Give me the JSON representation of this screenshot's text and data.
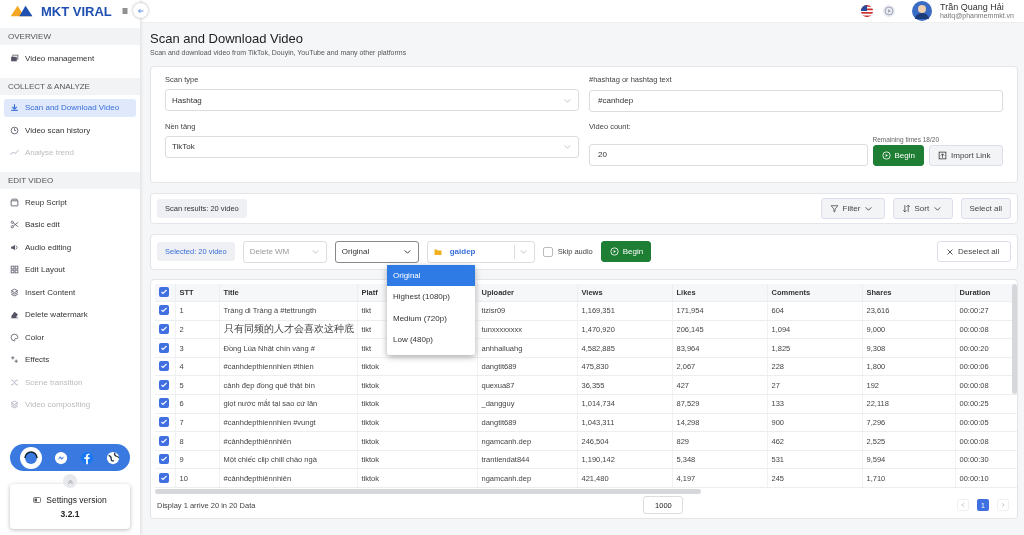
{
  "sidebar": {
    "logo": "MKT VIRAL",
    "sections": [
      {
        "title": "OVERVIEW",
        "items": [
          {
            "label": "Video management",
            "selected": false,
            "disabled": false
          }
        ]
      },
      {
        "title": "COLLECT & ANALYZE",
        "items": [
          {
            "label": "Scan and Download Video",
            "selected": true,
            "disabled": false
          },
          {
            "label": "Video scan history",
            "selected": false,
            "disabled": false
          },
          {
            "label": "Analyse trend",
            "selected": false,
            "disabled": true
          }
        ]
      },
      {
        "title": "EDIT VIDEO",
        "items": [
          {
            "label": "Reup Script",
            "selected": false,
            "disabled": false
          },
          {
            "label": "Basic edit",
            "selected": false,
            "disabled": false
          },
          {
            "label": "Audio editing",
            "selected": false,
            "disabled": false
          },
          {
            "label": "Edit Layout",
            "selected": false,
            "disabled": false
          },
          {
            "label": "Insert Content",
            "selected": false,
            "disabled": false
          },
          {
            "label": "Delete watermark",
            "selected": false,
            "disabled": false
          },
          {
            "label": "Color",
            "selected": false,
            "disabled": false
          },
          {
            "label": "Effects",
            "selected": false,
            "disabled": false
          },
          {
            "label": "Scene transition",
            "selected": false,
            "disabled": true
          },
          {
            "label": "Video compositing",
            "selected": false,
            "disabled": true
          }
        ]
      }
    ],
    "settings": {
      "label": "Settings version",
      "version": "3.2.1"
    }
  },
  "user": {
    "name": "Trần Quang Hải",
    "email": "haitq@phanmemmkt.vn"
  },
  "page": {
    "title": "Scan and Download Video",
    "subtitle": "Scan and download video from TikTok, Douyin, YouTube and many other platforms"
  },
  "form": {
    "scan_type": {
      "label": "Scan type",
      "value": "Hashtag"
    },
    "hashtag": {
      "label": "#hashtag or hashtag text",
      "value": "#canhdep"
    },
    "platform": {
      "label": "Nền tảng",
      "value": "TikTok"
    },
    "video_count": {
      "label": "Video count:",
      "value": "20"
    },
    "remaining": "Remaining times 18/20",
    "begin": "Begin",
    "import": "Import Link"
  },
  "results": {
    "count": "Scan results: 20 video",
    "filter": "Filter",
    "sort": "Sort",
    "select_all": "Select all"
  },
  "actions": {
    "selected": "Selected: 20 video",
    "watermark": {
      "placeholder": "Delete WM"
    },
    "quality": {
      "value": "Original",
      "expanded": true,
      "options": [
        {
          "label": "Original",
          "selected": true
        },
        {
          "label": "Highest (1080p)",
          "selected": false
        },
        {
          "label": "Medium (720p)",
          "selected": false
        },
        {
          "label": "Low (480p)",
          "selected": false
        }
      ]
    },
    "folder": "gaidep",
    "skip_audio": {
      "label": "Skip audio",
      "checked": false
    },
    "begin": "Begin",
    "deselect": "Deselect all"
  },
  "table": {
    "all_checked": true,
    "columns": [
      "STT",
      "Title",
      "Platf",
      "Uploader",
      "Views",
      "Likes",
      "Comments",
      "Shares",
      "Duration"
    ],
    "rows": [
      {
        "checked": true,
        "cells": [
          "1",
          "Tràng di Tràng à #tettrungth",
          "tikt",
          "tizisr09",
          "1,169,351",
          "171,954",
          "604",
          "23,616",
          "00:00:27"
        ]
      },
      {
        "checked": true,
        "cells": [
          "2",
          "只有同频的人才会喜欢这种底",
          "tikt",
          "tunxxxxxxxx",
          "1,470,920",
          "206,145",
          "1,094",
          "9,000",
          "00:00:08"
        ]
      },
      {
        "checked": true,
        "cells": [
          "3",
          "Đồng Lúa Nhật chín vàng #",
          "tikt",
          "anhhailuahg",
          "4,582,885",
          "83,964",
          "1,825",
          "9,308",
          "00:00:20"
        ]
      },
      {
        "checked": true,
        "cells": [
          "4",
          "#canhdepthiennhien #thien",
          "tiktok",
          "dangtit689",
          "475,830",
          "2,067",
          "228",
          "1,800",
          "00:00:06"
        ]
      },
      {
        "checked": true,
        "cells": [
          "5",
          "cảnh đẹp đồng quê thật bìn",
          "tiktok",
          "quexua87",
          "36,355",
          "427",
          "27",
          "192",
          "00:00:08"
        ]
      },
      {
        "checked": true,
        "cells": [
          "6",
          "giọt nước mắt tại sao cứ lăn",
          "tiktok",
          "_dangguy",
          "1,014,734",
          "87,529",
          "133",
          "22,118",
          "00:00:25"
        ]
      },
      {
        "checked": true,
        "cells": [
          "7",
          "#canhdepthiennhien #vungt",
          "tiktok",
          "dangtit689",
          "1,043,311",
          "14,298",
          "900",
          "7,296",
          "00:00:05"
        ]
      },
      {
        "checked": true,
        "cells": [
          "8",
          "#cảnhđẹpthiênnhiên",
          "tiktok",
          "ngamcanh.dep",
          "246,504",
          "829",
          "462",
          "2,525",
          "00:00:08"
        ]
      },
      {
        "checked": true,
        "cells": [
          "9",
          "Một chiếc clip chill chào ngà",
          "tiktok",
          "trantiendat844",
          "1,190,142",
          "5,348",
          "531",
          "9,594",
          "00:00:30"
        ]
      },
      {
        "checked": true,
        "cells": [
          "10",
          "#cảnhđẹpthiênnhiên",
          "tiktok",
          "ngamcanh.dep",
          "421,480",
          "4,197",
          "245",
          "1,710",
          "00:00:10"
        ]
      }
    ],
    "footer": "Display 1 arrive 20 in 20 Data",
    "page_size": "1000",
    "pages": [
      {
        "label": "1",
        "selected": true
      }
    ]
  }
}
